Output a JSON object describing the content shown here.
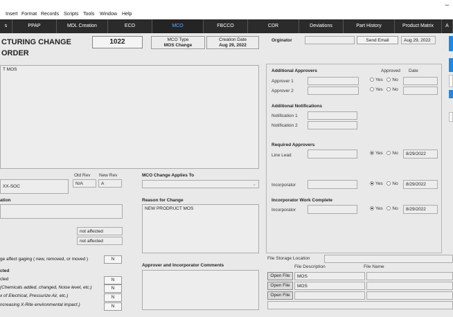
{
  "menu": [
    "Insert",
    "Format",
    "Records",
    "Scripts",
    "Tools",
    "Window",
    "Help"
  ],
  "window": {
    "minimize": "–"
  },
  "tabs": [
    {
      "label": "s"
    },
    {
      "label": "PPAP"
    },
    {
      "label": "MDL Creation"
    },
    {
      "label": "ECO"
    },
    {
      "label": "MCO"
    },
    {
      "label": "FBCCO"
    },
    {
      "label": "CDR"
    },
    {
      "label": "Deviations"
    },
    {
      "label": "Part History"
    },
    {
      "label": "Product Matrix"
    },
    {
      "label": "A"
    }
  ],
  "header": {
    "title": "CTURING CHANGE ORDER",
    "number": "1022",
    "mco_type_label": "MCO Type",
    "mco_type_value": "MOS Change",
    "creation_date_label": "Creation Date",
    "creation_date_value": "Aug 29, 2022",
    "originator_label": "Orginator",
    "originator_value": "",
    "send_email": "Send Email",
    "send_date": "Aug 29, 2022"
  },
  "description": {
    "text": "T MOS"
  },
  "part": {
    "old_rev_label": "Old Rev",
    "new_rev_label": "New Rev",
    "part_number": "XX-SOC",
    "old_rev": "N/A",
    "new_rev": "A"
  },
  "applies_to": {
    "label": "MCO Change Applies To",
    "value": ""
  },
  "location": {
    "label": "ation",
    "value": ""
  },
  "reason": {
    "label": "Reason for Change",
    "text": "NEW PRODRUCT MOS"
  },
  "affected": {
    "field1": "not affected",
    "field2": "not affected"
  },
  "gaging": {
    "label": "ge affect gaging ( new, removed, or moved )",
    "value": "N"
  },
  "checklist": {
    "heading": "cted",
    "items": [
      {
        "label": "cted",
        "value": "N"
      },
      {
        "label": "(Chemicals added, changed, Noise level, etc.)",
        "value": "N"
      },
      {
        "label": "x of Electrical, Pressurize Air, etc.)",
        "value": "N"
      },
      {
        "label": "ncreasing X-Rite environmental impact.)",
        "value": "N"
      }
    ]
  },
  "comments": {
    "label": "Approver and Incorporator Comments",
    "text": ""
  },
  "approvals": {
    "additional_approvers_heading": "Additional Approvers",
    "approved_col": "Approved",
    "date_col": "Date",
    "approver1_label": "Approver 1",
    "approver2_label": "Approver 2",
    "yes": "Yes",
    "no": "No",
    "notifications_heading": "Additional Notifications",
    "notification1_label": "Notification 1",
    "notification2_label": "Notification 2",
    "required_heading": "Required Approvers",
    "line_lead_label": "Line Lead",
    "line_lead_date": "8/29/2022",
    "incorporator_label": "Incorporator",
    "incorporator_date": "8/29/2022",
    "work_complete_heading": "Incorporator Work Complete",
    "work_incorporator_label": "Incorporator",
    "work_date": "8/29/2022"
  },
  "files": {
    "storage_label": "File Storage Location",
    "desc_col": "File Description",
    "name_col": "File Name",
    "open_label": "Open File",
    "rows": [
      {
        "desc": "MOS",
        "name": ""
      },
      {
        "desc": "MOS",
        "name": ""
      },
      {
        "desc": "",
        "name": ""
      }
    ]
  },
  "colors": {
    "tab_bar": "#2b2b2b",
    "active_tab": "#6aa7ff",
    "side_button": "#1e88e5"
  }
}
